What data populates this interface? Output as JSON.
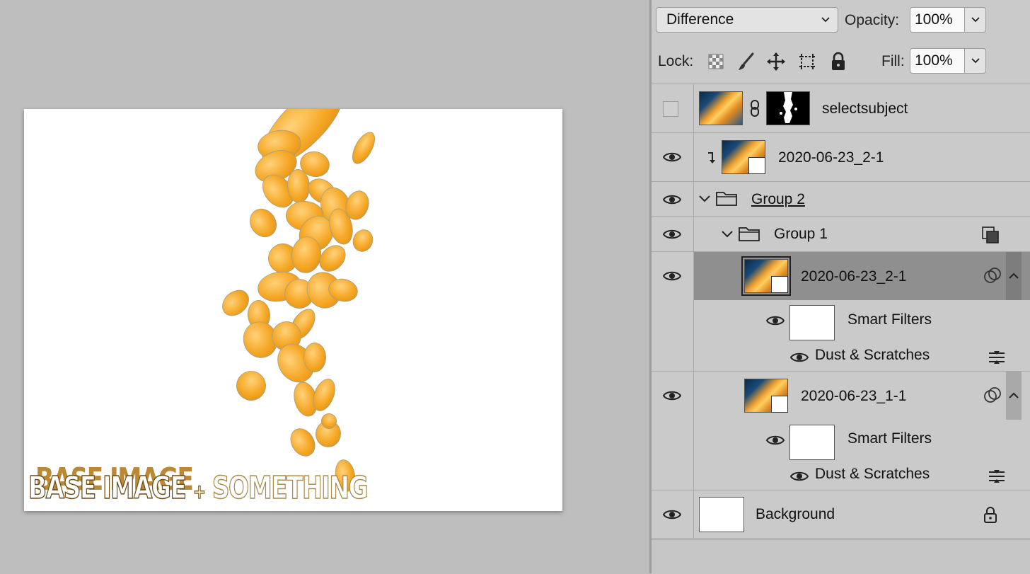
{
  "canvas": {
    "overlay_text": {
      "part1": "BASE IMAGE",
      "part2": "+",
      "part3": "SOMETHING"
    }
  },
  "panel": {
    "blend_mode": "Difference",
    "opacity_label": "Opacity:",
    "opacity_value": "100%",
    "lock_label": "Lock:",
    "fill_label": "Fill:",
    "fill_value": "100%"
  },
  "layers": [
    {
      "name": "selectsubject",
      "visible": false,
      "has_mask": true
    },
    {
      "name": "2020-06-23_2-1",
      "visible": true,
      "clipped": true,
      "smart_object": true
    },
    {
      "name": "Group 2",
      "visible": true,
      "type": "group",
      "expanded": true,
      "underlined": true
    },
    {
      "name": "Group 1",
      "visible": true,
      "type": "group",
      "expanded": true
    },
    {
      "name": "2020-06-23_2-1",
      "visible": true,
      "smart_object": true,
      "selected": true
    },
    {
      "name": "Smart Filters",
      "visible": true,
      "type": "smart-filters"
    },
    {
      "name": "Dust & Scratches",
      "visible": true,
      "type": "filter"
    },
    {
      "name": "2020-06-23_1-1",
      "visible": true,
      "smart_object": true
    },
    {
      "name": "Smart Filters",
      "visible": true,
      "type": "smart-filters"
    },
    {
      "name": "Dust & Scratches",
      "visible": true,
      "type": "filter"
    },
    {
      "name": "Background",
      "visible": true,
      "locked": true
    }
  ],
  "colors": {
    "panel_bg": "#cacaca",
    "selected_row": "#8f8f8f",
    "canvas_bg": "#bebebe",
    "flake": "#f5a623"
  }
}
